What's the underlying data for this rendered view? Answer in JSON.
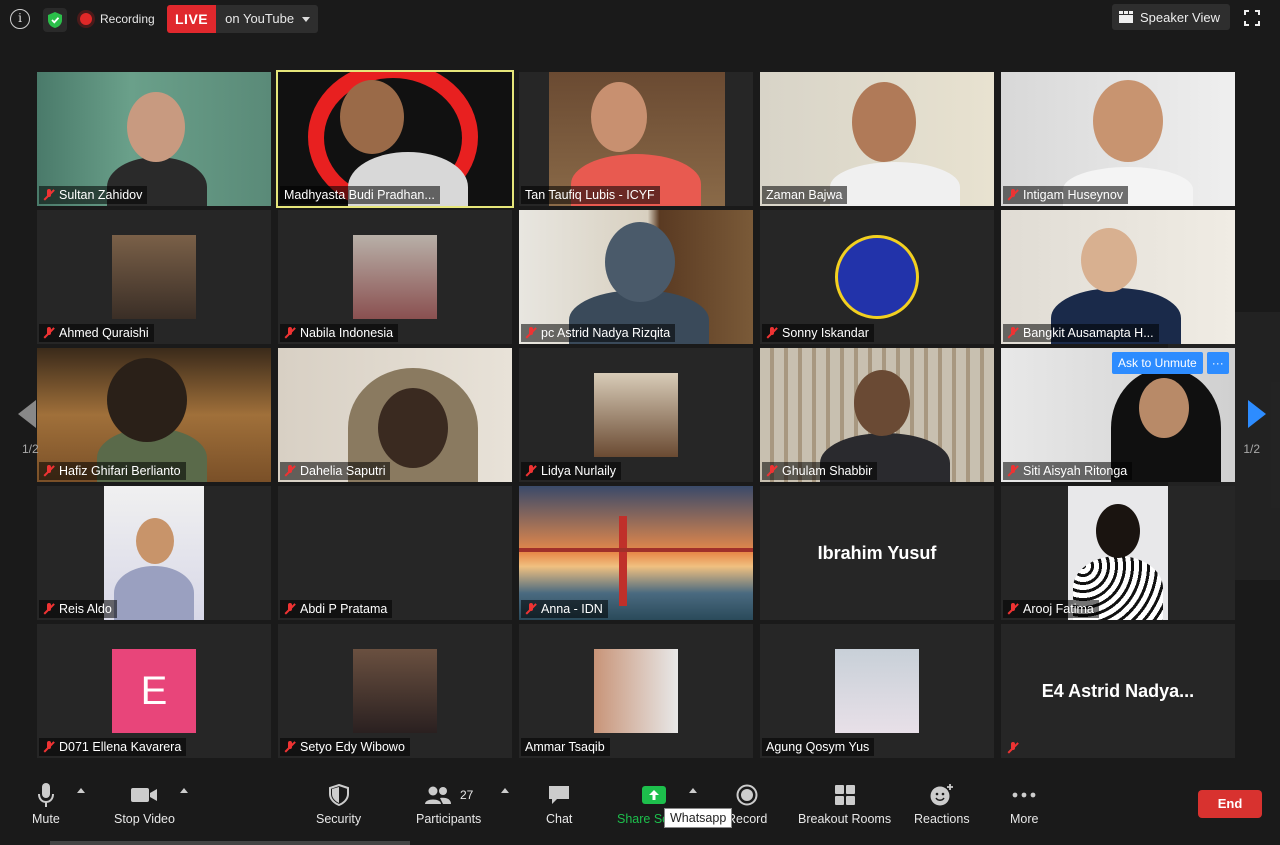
{
  "topbar": {
    "recording_label": "Recording",
    "live_label": "LIVE",
    "stream_label": "on YouTube",
    "speaker_view_label": "Speaker View"
  },
  "participants": [
    {
      "name": "Sultan Zahidov",
      "muted": true
    },
    {
      "name": "Madhyasta Budi Pradhan...",
      "muted": false,
      "active": true
    },
    {
      "name": "Tan Taufiq Lubis - ICYF",
      "muted": false
    },
    {
      "name": "Zaman Bajwa",
      "muted": false
    },
    {
      "name": "Intigam Huseynov",
      "muted": true
    },
    {
      "name": "Ahmed Quraishi",
      "muted": true
    },
    {
      "name": "Nabila Indonesia",
      "muted": true
    },
    {
      "name": "pc Astrid Nadya Rizqita",
      "muted": true
    },
    {
      "name": "Sonny Iskandar",
      "muted": true
    },
    {
      "name": "Bangkit Ausamapta H...",
      "muted": true
    },
    {
      "name": "Hafiz Ghifari Berlianto",
      "muted": true
    },
    {
      "name": "Dahelia Saputri",
      "muted": true
    },
    {
      "name": "Lidya Nurlaily",
      "muted": true
    },
    {
      "name": "Ghulam Shabbir",
      "muted": true
    },
    {
      "name": "Siti Aisyah Ritonga",
      "muted": true
    },
    {
      "name": "Reis Aldo",
      "muted": true
    },
    {
      "name": "Abdi P Pratama",
      "muted": true
    },
    {
      "name": "Anna - IDN",
      "muted": true
    },
    {
      "name": "Ibrahim Yusuf",
      "muted": false,
      "name_only": true
    },
    {
      "name": "Arooj Fatima",
      "muted": true
    },
    {
      "name": "D071 Ellena Kavarera",
      "muted": true,
      "initial": "E"
    },
    {
      "name": "Setyo Edy Wibowo",
      "muted": true
    },
    {
      "name": "Ammar Tsaqib",
      "muted": false
    },
    {
      "name": "Agung Qosym Yus",
      "muted": false
    },
    {
      "name": "E4  Astrid  Nadya...",
      "muted": true,
      "name_only": true
    }
  ],
  "nav": {
    "page_left": "1/2",
    "page_right": "1/2"
  },
  "popup": {
    "ask_to_unmute": "Ask to Unmute",
    "more": "···"
  },
  "toolbar": {
    "mute": "Mute",
    "stop_video": "Stop Video",
    "security": "Security",
    "participants": "Participants",
    "participants_count": "27",
    "chat": "Chat",
    "share_screen": "Share Sc",
    "record": "Record",
    "breakout_rooms": "Breakout Rooms",
    "reactions": "Reactions",
    "more": "More",
    "end": "End",
    "tooltip": "Whatsapp"
  },
  "colors": {
    "live_red": "#e0282d",
    "accent_blue": "#2d8cff",
    "share_green": "#1dbf4c",
    "end_red": "#d8322f",
    "active_outline": "#e6e67a"
  }
}
